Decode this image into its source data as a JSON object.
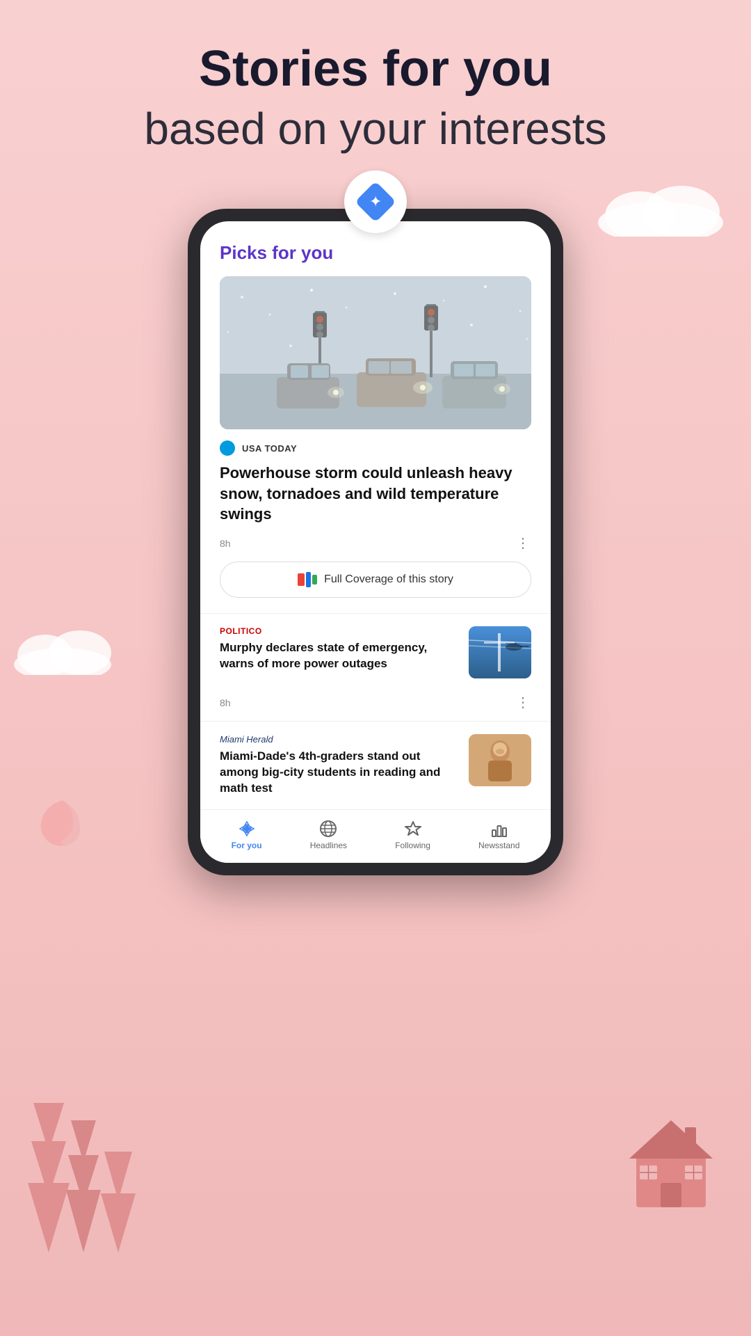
{
  "header": {
    "line1": "Stories for you",
    "line2": "based on your interests"
  },
  "phone": {
    "picks_title": "Picks for you",
    "article1": {
      "source": "USA TODAY",
      "source_color": "#009bde",
      "title": "Powerhouse storm could unleash heavy snow, tornadoes and wild temperature swings",
      "time": "8h",
      "full_coverage": "Full Coverage of this story"
    },
    "article2": {
      "source": "POLITICO",
      "source_type": "red",
      "title": "Murphy declares state of emergency, warns of more power outages",
      "time": "8h"
    },
    "article3": {
      "source": "Miami Herald",
      "source_type": "miami",
      "title": "Miami-Dade's 4th-graders stand out among big-city students in reading and math test"
    }
  },
  "bottom_nav": {
    "items": [
      {
        "label": "For you",
        "active": true
      },
      {
        "label": "Headlines",
        "active": false
      },
      {
        "label": "Following",
        "active": false
      },
      {
        "label": "Newsstand",
        "active": false
      }
    ]
  }
}
